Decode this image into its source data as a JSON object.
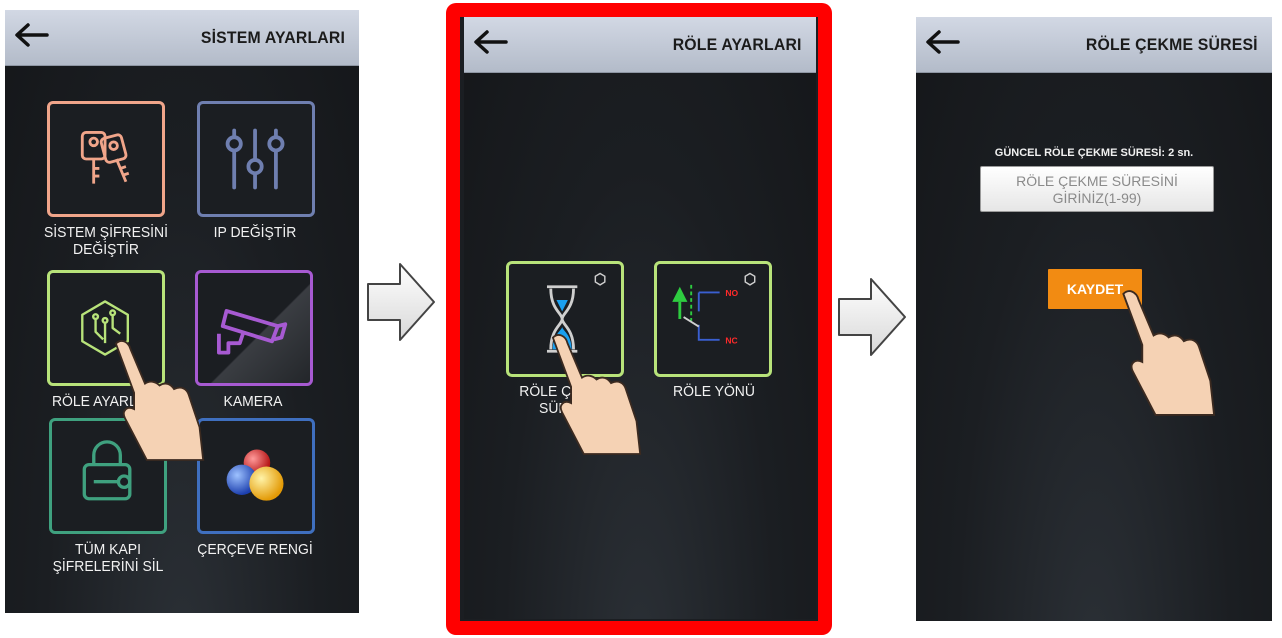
{
  "screens": [
    {
      "title": "SİSTEM AYARLARI",
      "tiles": [
        {
          "label_line1": "SİSTEM ŞİFRESİNİ",
          "label_line2": "DEĞİŞTİR",
          "icon": "keys-icon",
          "color": "#f0a58a"
        },
        {
          "label_line1": "IP DEĞİŞTİR",
          "label_line2": "",
          "icon": "sliders-icon",
          "color": "#6f7fb0"
        },
        {
          "label_line1": "RÖLE AYARLARI",
          "label_line2": "",
          "icon": "circuit-icon",
          "color": "#b8e37a"
        },
        {
          "label_line1": "KAMERA",
          "label_line2": "",
          "icon": "camera-icon",
          "color": "#a75ad2"
        },
        {
          "label_line1": "TÜM KAPI",
          "label_line2": "ŞİFRELERİNİ SİL",
          "icon": "padlock-key-icon",
          "color": "#3fa17f"
        },
        {
          "label_line1": "ÇERÇEVE RENGİ",
          "label_line2": "",
          "icon": "color-balls-icon",
          "color": "#3f6fbf"
        }
      ]
    },
    {
      "title": "RÖLE AYARLARI",
      "tiles": [
        {
          "label_line1": "RÖLE ÇEKME",
          "label_line2": "SÜRESİ",
          "icon": "hourglass-icon",
          "color": "#b8e37a"
        },
        {
          "label_line1": "RÖLE YÖNÜ",
          "label_line2": "",
          "icon": "relay-switch-icon",
          "color": "#b8e37a"
        }
      ],
      "relay_labels": {
        "no": "NO",
        "nc": "NC"
      }
    },
    {
      "title": "RÖLE ÇEKME SÜRESİ",
      "current_label": "GÜNCEL RÖLE ÇEKME SÜRESİ: 2 sn.",
      "input_placeholder_line1": "RÖLE ÇEKME SÜRESİNİ",
      "input_placeholder_line2": "GİRİNİZ(1-99)",
      "save_label": "KAYDET"
    }
  ],
  "colors": {
    "highlight_frame": "#ff0000",
    "topbar": "#c3cad7",
    "save_button": "#f28b12"
  }
}
